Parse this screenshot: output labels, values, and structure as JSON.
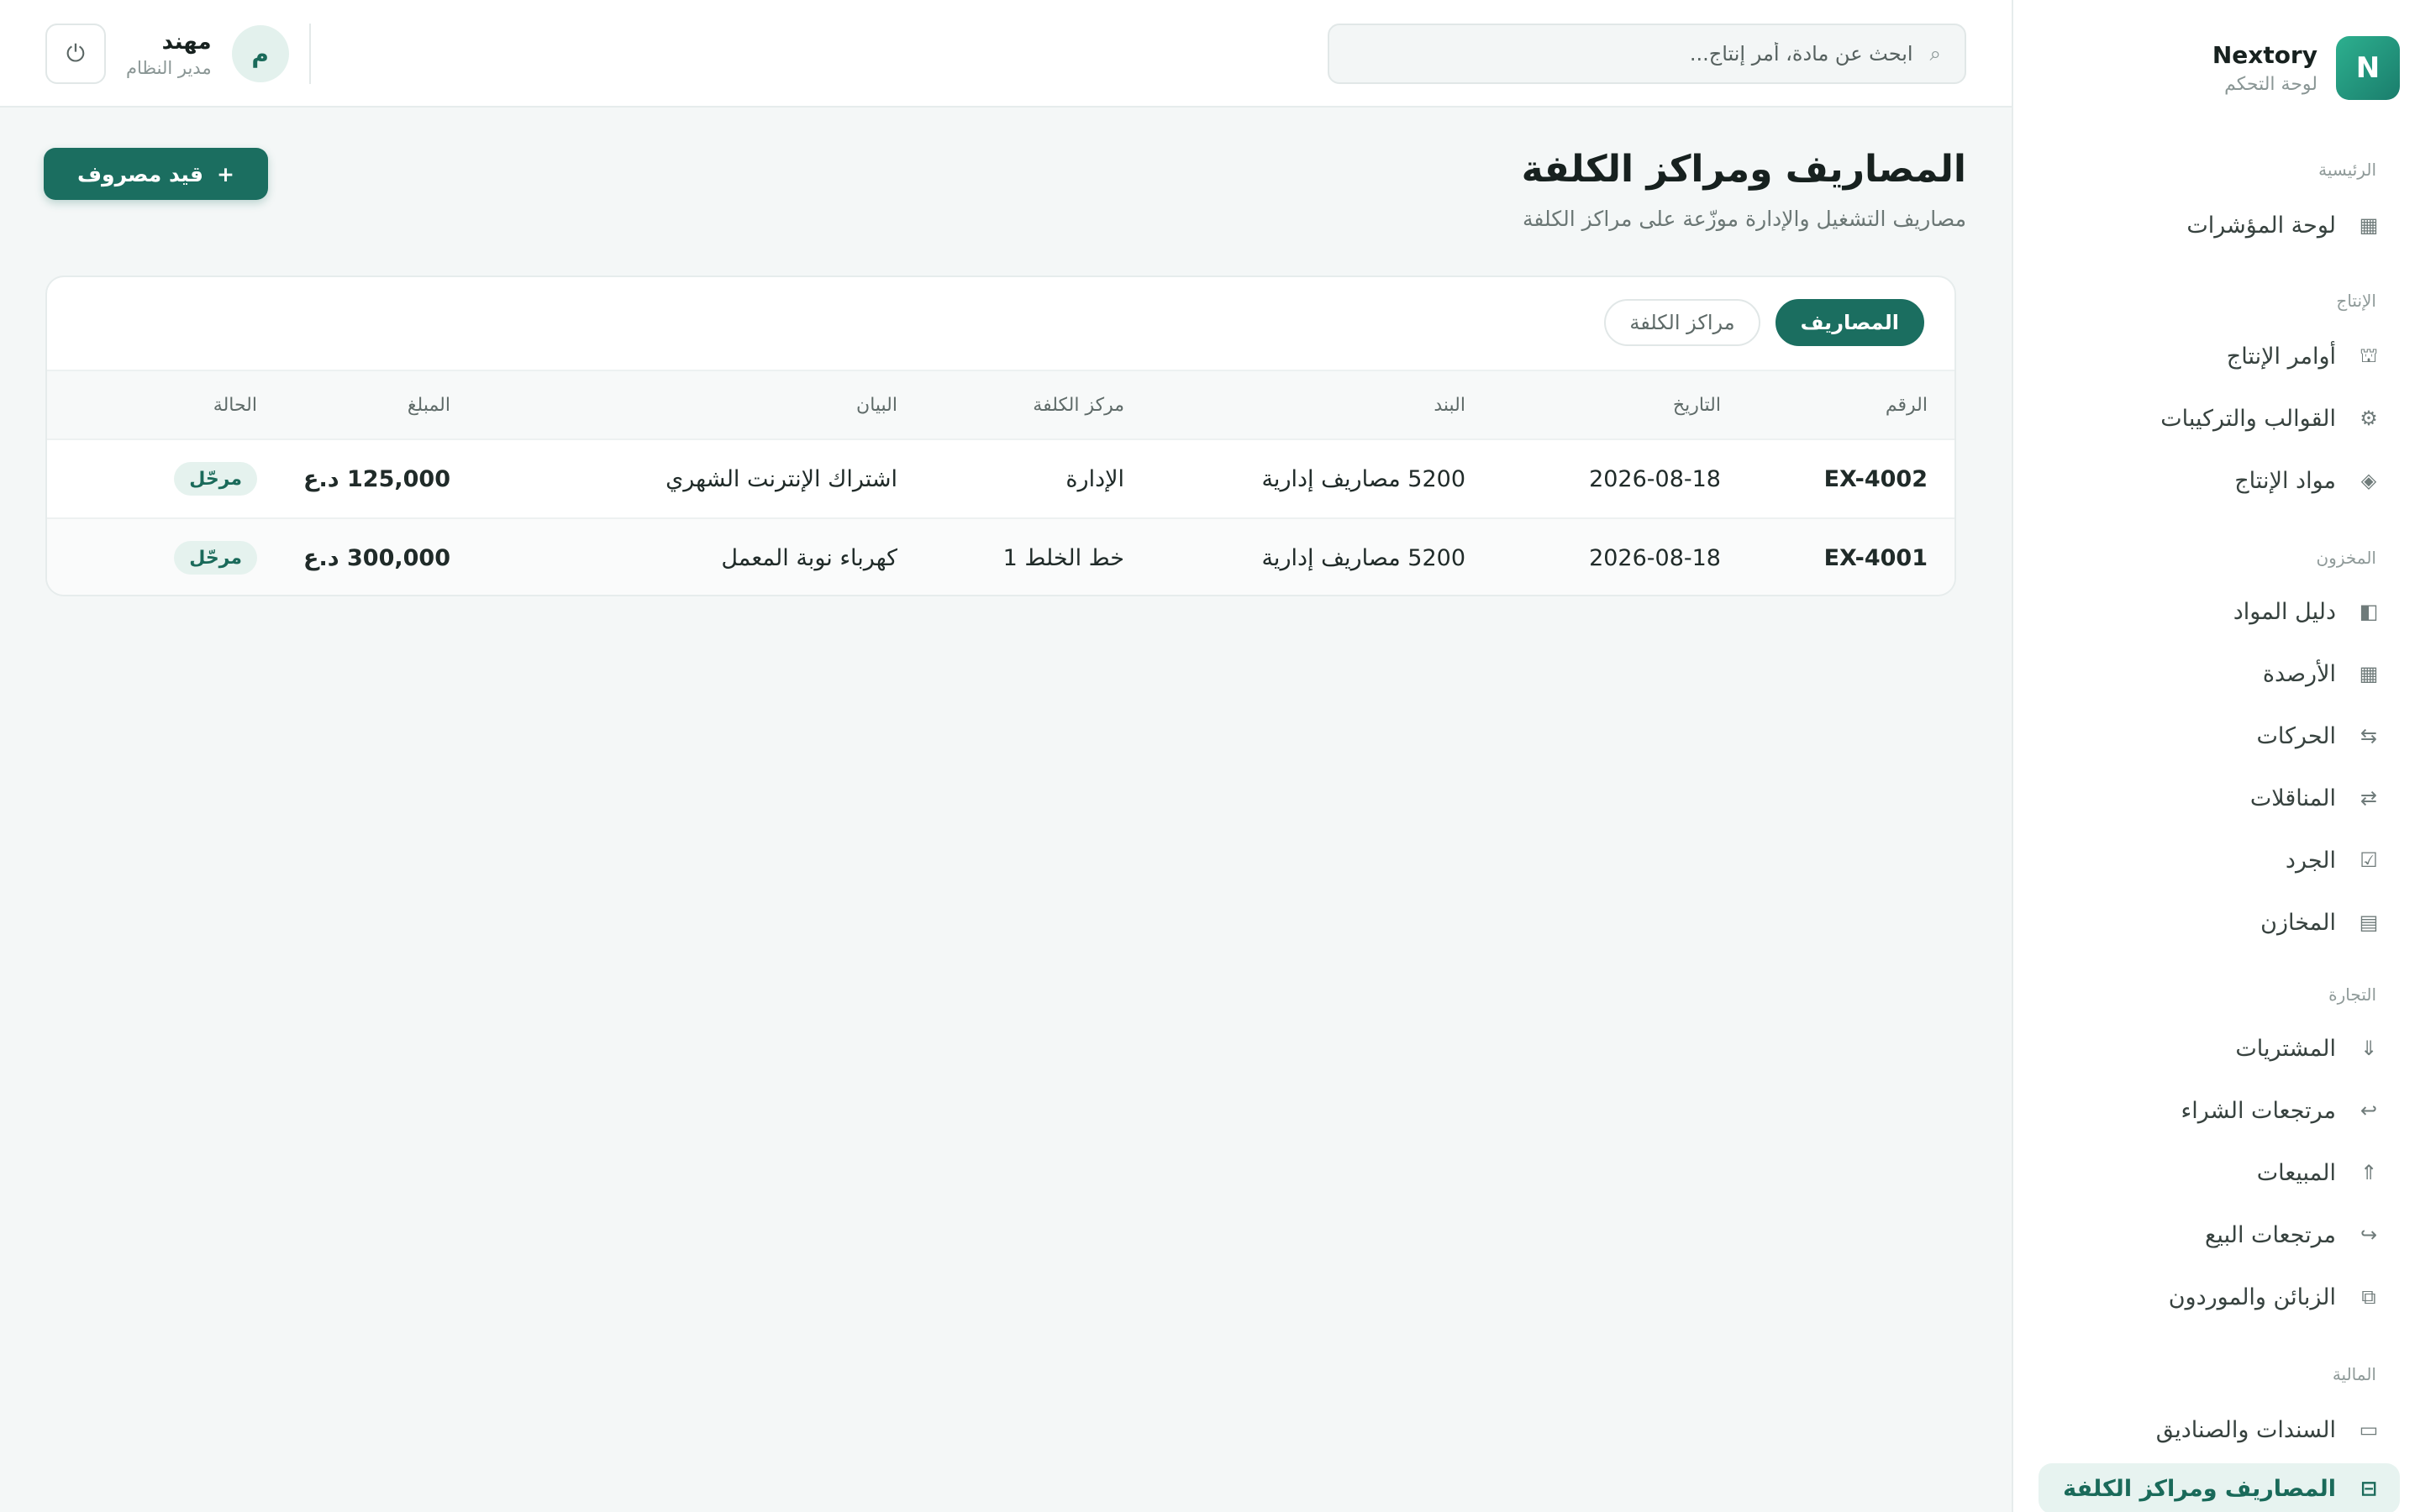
{
  "brand": {
    "logo_letter": "N",
    "name": "Nextory",
    "subtitle": "لوحة التحكم"
  },
  "sidebar": {
    "sections": {
      "home": "الرئيسية",
      "production": "الإنتاج",
      "inventory": "المخزون",
      "trade": "التجارة",
      "finance": "المالية"
    },
    "items": [
      {
        "label": "لوحة المؤشرات",
        "icon": "grid-icon",
        "glyph": "▦"
      },
      {
        "label": "أوامر الإنتاج",
        "icon": "factory-icon",
        "glyph": "⛫"
      },
      {
        "label": "القوالب والتركيبات",
        "icon": "gear-icon",
        "glyph": "⚙"
      },
      {
        "label": "مواد الإنتاج",
        "icon": "diamond-icon",
        "glyph": "◈"
      },
      {
        "label": "دليل المواد",
        "icon": "book-icon",
        "glyph": "◧"
      },
      {
        "label": "الأرصدة",
        "icon": "grid-icon",
        "glyph": "▦"
      },
      {
        "label": "الحركات",
        "icon": "movements-icon",
        "glyph": "⇆"
      },
      {
        "label": "المناقلات",
        "icon": "transfer-icon",
        "glyph": "⇄"
      },
      {
        "label": "الجرد",
        "icon": "checkbox-icon",
        "glyph": "☑"
      },
      {
        "label": "المخازن",
        "icon": "warehouse-icon",
        "glyph": "▤"
      },
      {
        "label": "المشتريات",
        "icon": "arrow-down-icon",
        "glyph": "⇓"
      },
      {
        "label": "مرتجعات الشراء",
        "icon": "return-icon",
        "glyph": "↩"
      },
      {
        "label": "المبيعات",
        "icon": "arrow-up-icon",
        "glyph": "⇑"
      },
      {
        "label": "مرتجعات البيع",
        "icon": "return-forward-icon",
        "glyph": "↪"
      },
      {
        "label": "الزبائن والموردون",
        "icon": "contacts-icon",
        "glyph": "⧉"
      },
      {
        "label": "السندات والصناديق",
        "icon": "cash-icon",
        "glyph": "▭"
      },
      {
        "label": "المصاريف ومراكز الكلفة",
        "icon": "expenses-icon",
        "glyph": "⊟"
      }
    ]
  },
  "topbar": {
    "search_placeholder": "ابحث عن مادة، أمر إنتاج...",
    "search_glyph": "⌕",
    "user_name": "مهند",
    "user_role": "مدير النظام",
    "avatar_letter": "م",
    "logout_glyph": "⏻"
  },
  "page": {
    "title": "المصاريف ومراكز الكلفة",
    "subtitle": "مصاريف التشغيل والإدارة موزّعة على مراكز الكلفة",
    "add_button": "قيد مصروف",
    "add_glyph": "+"
  },
  "tabs": {
    "expenses": "المصاريف",
    "cost_centers": "مراكز الكلفة"
  },
  "table": {
    "headers": {
      "id": "الرقم",
      "date": "التاريخ",
      "item": "البند",
      "center": "مركز الكلفة",
      "desc": "البيان",
      "amount": "المبلغ",
      "status": "الحالة"
    },
    "rows": [
      {
        "id": "EX-4002",
        "date": "2026-08-18",
        "item": "5200 مصاريف إدارية",
        "center": "الإدارة",
        "desc": "اشتراك الإنترنت الشهري",
        "amount": "125,000 د.ع",
        "status": "مرحّل"
      },
      {
        "id": "EX-4001",
        "date": "2026-08-18",
        "item": "5200 مصاريف إدارية",
        "center": "خط الخلط 1",
        "desc": "كهرباء نوبة المعمل",
        "amount": "300,000 د.ع",
        "status": "مرحّل"
      }
    ]
  },
  "colors": {
    "accent": "#1b6e60",
    "brand_gradient_start": "#2db08f",
    "brand_gradient_end": "#1a7d6c"
  }
}
